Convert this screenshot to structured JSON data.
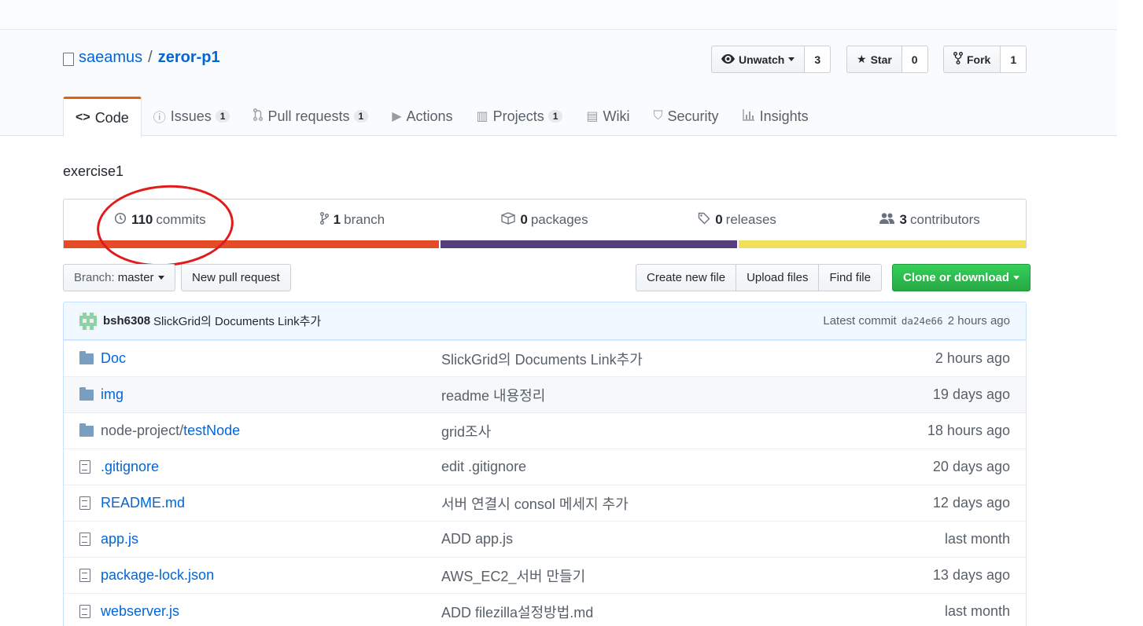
{
  "repo": {
    "owner": "saeamus",
    "separator": "/",
    "name": "zeror-p1",
    "description": "exercise1"
  },
  "header_actions": {
    "watch": {
      "label": "Unwatch",
      "count": "3"
    },
    "star": {
      "label": "Star",
      "count": "0"
    },
    "fork": {
      "label": "Fork",
      "count": "1"
    }
  },
  "tabs": [
    {
      "label": "Code",
      "icon": "<>",
      "count": ""
    },
    {
      "label": "Issues",
      "icon": "issue-icon",
      "count": "1"
    },
    {
      "label": "Pull requests",
      "icon": "pull-request-icon",
      "count": "1"
    },
    {
      "label": "Actions",
      "icon": "play-icon",
      "count": ""
    },
    {
      "label": "Projects",
      "icon": "project-icon",
      "count": "1"
    },
    {
      "label": "Wiki",
      "icon": "book-icon",
      "count": ""
    },
    {
      "label": "Security",
      "icon": "shield-icon",
      "count": ""
    },
    {
      "label": "Insights",
      "icon": "graph-icon",
      "count": ""
    }
  ],
  "summary": {
    "commits": {
      "num": "110",
      "label": "commits"
    },
    "branches": {
      "num": "1",
      "label": "branch"
    },
    "packages": {
      "num": "0",
      "label": "packages"
    },
    "releases": {
      "num": "0",
      "label": "releases"
    },
    "contributors": {
      "num": "3",
      "label": "contributors"
    }
  },
  "language_bar": [
    {
      "color": "#e34c26",
      "percent": 39
    },
    {
      "color": "#563d7c",
      "percent": 31
    },
    {
      "color": "#f1e05a",
      "percent": 30
    }
  ],
  "file_actions": {
    "branch_prefix": "Branch:",
    "branch": "master",
    "new_pull_request": "New pull request",
    "create_new_file": "Create new file",
    "upload_files": "Upload files",
    "find_file": "Find file",
    "clone": "Clone or download"
  },
  "latest_commit": {
    "author": "bsh6308",
    "message": "SlickGrid의 Documents Link추가",
    "prefix": "Latest commit",
    "sha": "da24e66",
    "age": "2 hours ago"
  },
  "files": [
    {
      "type": "dir",
      "name": "Doc",
      "prefix": "",
      "message": "SlickGrid의 Documents Link추가",
      "age": "2 hours ago"
    },
    {
      "type": "dir",
      "name": "img",
      "prefix": "",
      "message": "readme 내용정리",
      "age": "19 days ago"
    },
    {
      "type": "dir",
      "name": "testNode",
      "prefix": "node-project/",
      "message": "grid조사",
      "age": "18 hours ago"
    },
    {
      "type": "file",
      "name": ".gitignore",
      "prefix": "",
      "message": "edit .gitignore",
      "age": "20 days ago"
    },
    {
      "type": "file",
      "name": "README.md",
      "prefix": "",
      "message": "서버 연결시 consol 메세지 추가",
      "age": "12 days ago"
    },
    {
      "type": "file",
      "name": "app.js",
      "prefix": "",
      "message": "ADD app.js",
      "age": "last month"
    },
    {
      "type": "file",
      "name": "package-lock.json",
      "prefix": "",
      "message": "AWS_EC2_서버 만들기",
      "age": "13 days ago"
    },
    {
      "type": "file",
      "name": "webserver.js",
      "prefix": "",
      "message": "ADD filezilla설정방법.md",
      "age": "last month"
    }
  ]
}
